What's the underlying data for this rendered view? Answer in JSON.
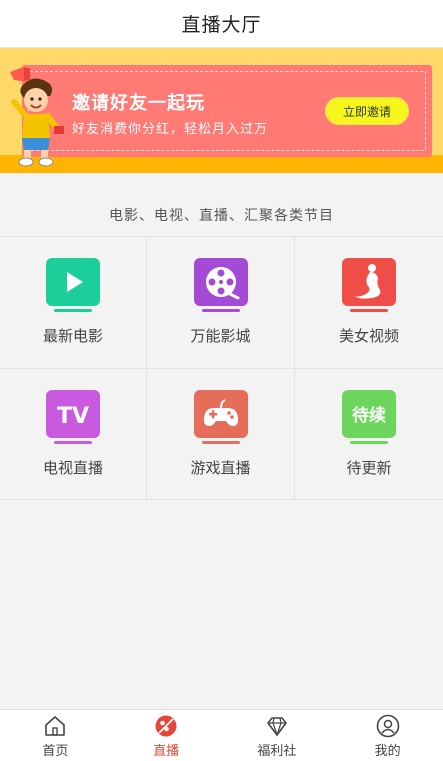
{
  "header": {
    "title": "直播大厅"
  },
  "banner": {
    "title": "邀请好友一起玩",
    "subtitle": "好友消费你分红，轻松月入过万",
    "button": "立即邀请"
  },
  "section": {
    "caption": "电影、电视、直播、汇聚各类节目"
  },
  "grid": {
    "items": [
      {
        "label": "最新电影",
        "icon": "play-icon",
        "color": "#1ccf9a"
      },
      {
        "label": "万能影城",
        "icon": "film-reel-icon",
        "color": "#a44bd6"
      },
      {
        "label": "美女视频",
        "icon": "lady-silhouette-icon",
        "color": "#ef4d47"
      },
      {
        "label": "电视直播",
        "icon": "tv-icon",
        "icon_text": "TV",
        "color": "#c95ae0"
      },
      {
        "label": "游戏直播",
        "icon": "gamepad-icon",
        "color": "#e56d5a"
      },
      {
        "label": "待更新",
        "icon": "pending-icon",
        "icon_text": "待续",
        "color": "#6bd65b"
      }
    ]
  },
  "tabbar": {
    "items": [
      {
        "label": "首页",
        "icon": "home-icon",
        "active": false
      },
      {
        "label": "直播",
        "icon": "live-icon",
        "active": true
      },
      {
        "label": "福利社",
        "icon": "diamond-icon",
        "active": false
      },
      {
        "label": "我的",
        "icon": "user-icon",
        "active": false
      }
    ],
    "active_color": "#e4473a"
  }
}
